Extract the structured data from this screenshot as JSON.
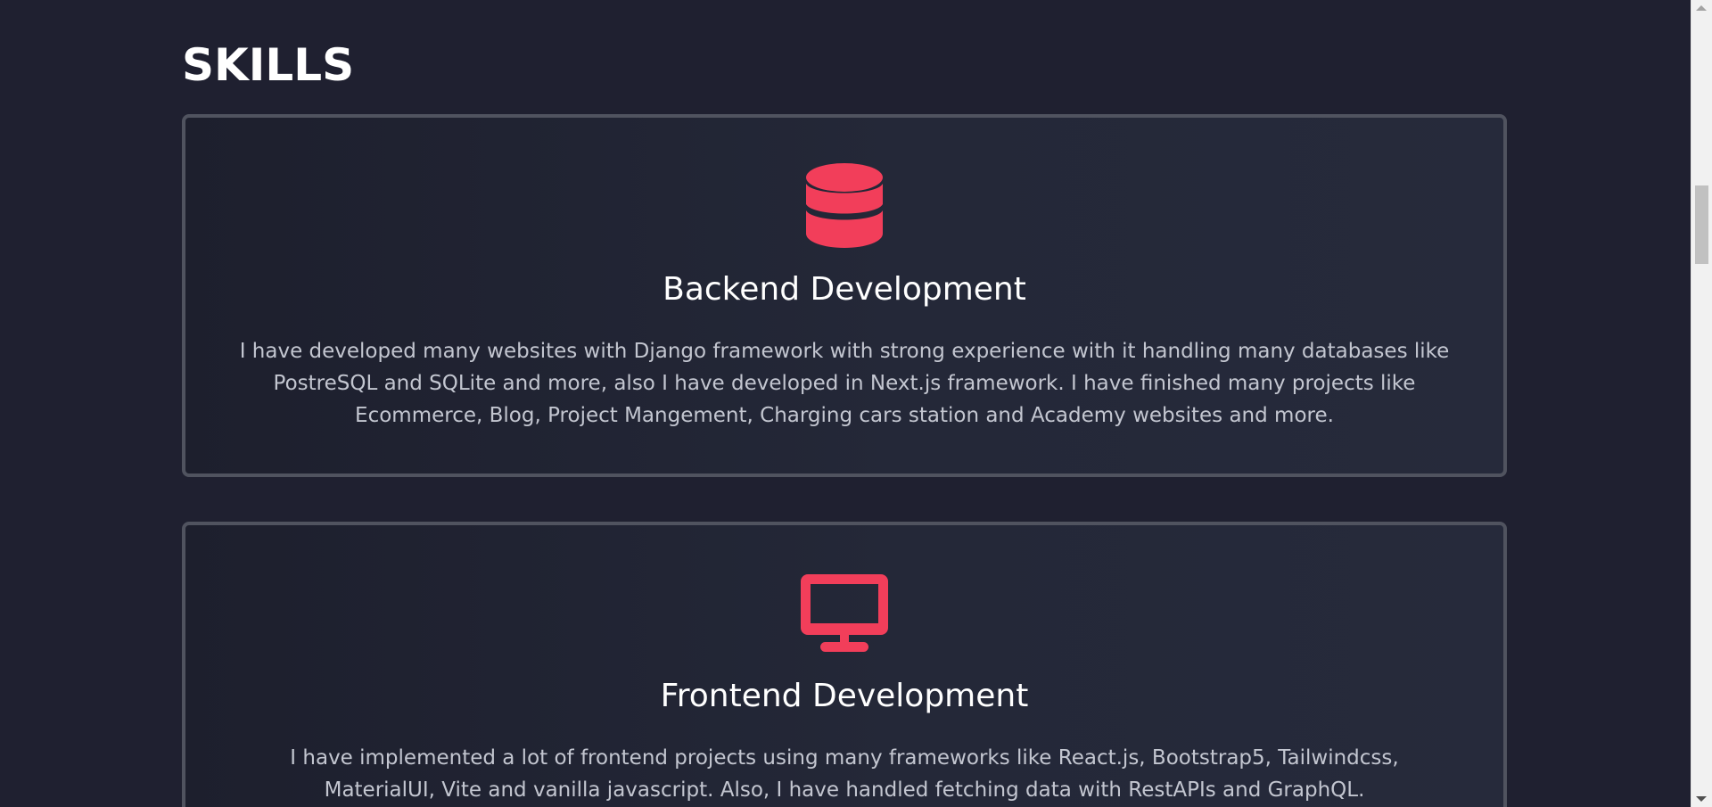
{
  "section": {
    "title": "SKILLS"
  },
  "skills": [
    {
      "icon": "database-icon",
      "title": "Backend Development",
      "description": "I have developed many websites with Django framework with strong experience with it handling many databases like PostreSQL and SQLite and more, also I have developed in Next.js framework. I have finished many projects like Ecommerce, Blog, Project Mangement, Charging cars station and Academy websites and more."
    },
    {
      "icon": "desktop-monitor-icon",
      "title": "Frontend Development",
      "description": "I have implemented a lot of frontend projects using many frameworks like React.js, Bootstrap5, Tailwindcss, MaterialUI, Vite and vanilla javascript. Also, I have handled fetching data with RestAPIs and GraphQL."
    }
  ],
  "colors": {
    "background": "#1f2030",
    "accent": "#f23e5a",
    "card_border": "#50535f",
    "text": "#ffffff",
    "muted_text": "#c3c6d0"
  }
}
